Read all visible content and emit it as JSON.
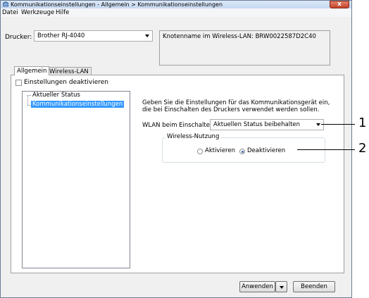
{
  "window": {
    "title": "Kommunikationseinstellungen - Allgemein > Kommunikationseinstellungen",
    "close_label": "x"
  },
  "menu": {
    "items": [
      {
        "label": "Datei"
      },
      {
        "label": "Werkzeuge"
      },
      {
        "label": "Hilfe"
      }
    ]
  },
  "printer": {
    "label": "Drucker:",
    "selected": "Brother RJ-4040",
    "node_info": "Knotenname im Wireless-LAN: BRW0022587D2C40"
  },
  "tabs": [
    {
      "label": "Allgemein",
      "active": true
    },
    {
      "label": "Wireless-LAN",
      "active": false
    }
  ],
  "panel": {
    "disable_checkbox_label": "Einstellungen deaktivieren",
    "disable_checked": false,
    "tree": {
      "items": [
        "Aktueller Status",
        "Kommunikationseinstellungen"
      ],
      "selected": "Kommunikationseinstellungen"
    },
    "description": "Geben Sie die Einstellungen für das Kommunikationsgerät ein, die bei Einschalten des Druckers verwendet werden sollen.",
    "wlan_label": "WLAN beim Einschalten:",
    "wlan_selected": "Aktuellen Status beibehalten",
    "wireless_group": {
      "legend": "Wireless-Nutzung",
      "options": [
        {
          "label": "Aktivieren",
          "checked": false
        },
        {
          "label": "Deaktivieren",
          "checked": true
        }
      ]
    }
  },
  "footer": {
    "apply_label": "Anwenden",
    "close_label": "Beenden"
  },
  "callouts": [
    "1",
    "2"
  ],
  "colors": {
    "selection": "#3399ff",
    "close_button": "#c2432d"
  }
}
